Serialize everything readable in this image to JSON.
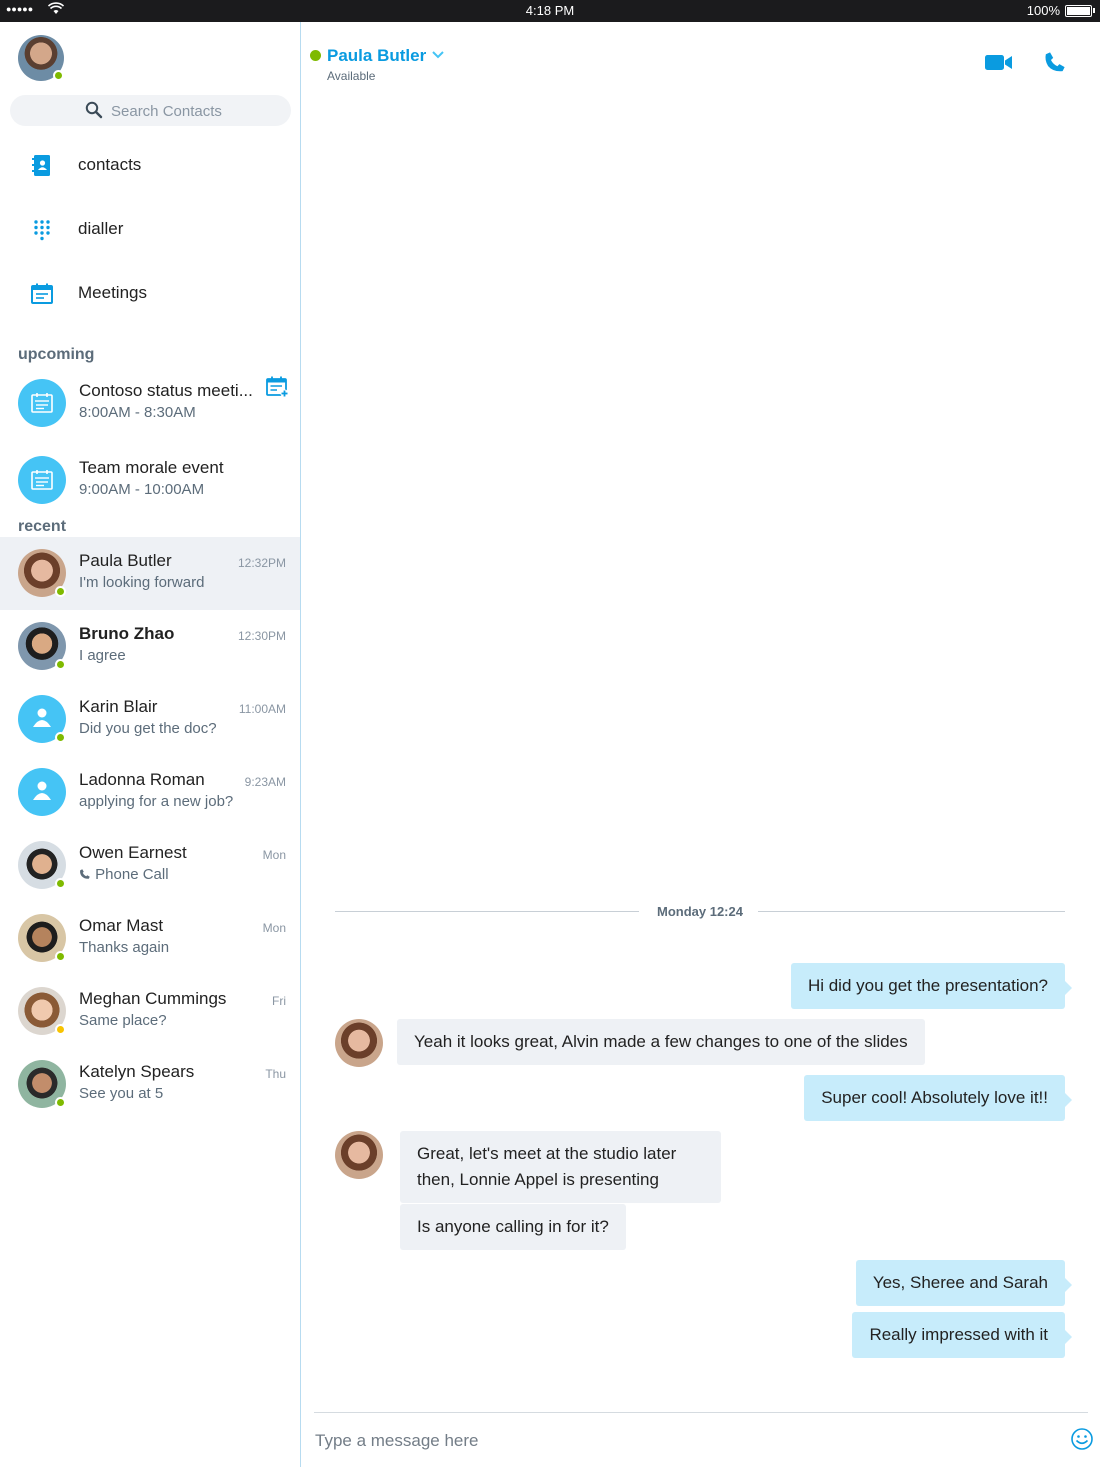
{
  "status_bar": {
    "signal": "●●●●●",
    "time": "4:18 PM",
    "battery": "100%"
  },
  "sidebar": {
    "search_placeholder": "Search Contacts",
    "nav": [
      {
        "label": "contacts",
        "icon": "contacts-book-icon"
      },
      {
        "label": "dialler",
        "icon": "dialpad-icon"
      },
      {
        "label": "Meetings",
        "icon": "calendar-icon"
      }
    ],
    "upcoming_title": "upcoming",
    "upcoming": [
      {
        "title": "Contoso status meeti...",
        "time": "8:00AM - 8:30AM"
      },
      {
        "title": "Team morale event",
        "time": "9:00AM - 10:00AM"
      }
    ],
    "recent_title": "recent",
    "recent": [
      {
        "name": "Paula Butler",
        "message": "I'm looking forward",
        "time": "12:32PM",
        "presence": "online"
      },
      {
        "name": "Bruno Zhao",
        "message": "I agree",
        "time": "12:30PM",
        "presence": "online"
      },
      {
        "name": "Karin Blair",
        "message": "Did you get the doc?",
        "time": "11:00AM",
        "presence": "online"
      },
      {
        "name": "Ladonna Roman",
        "message": "applying for a new job?",
        "time": "9:23AM",
        "presence": "none"
      },
      {
        "name": "Owen Earnest",
        "message": "Phone Call",
        "time": "Mon",
        "presence": "online"
      },
      {
        "name": "Omar Mast",
        "message": "Thanks again",
        "time": "Mon",
        "presence": "online"
      },
      {
        "name": "Meghan Cummings",
        "message": "Same place?",
        "time": "Fri",
        "presence": "away"
      },
      {
        "name": "Katelyn Spears",
        "message": "See you at 5",
        "time": "Thu",
        "presence": "online"
      }
    ]
  },
  "chat": {
    "contact_name": "Paula Butler",
    "contact_status": "Available",
    "date_divider": "Monday 12:24",
    "messages": [
      {
        "dir": "out",
        "text": "Hi did you get the presentation?"
      },
      {
        "dir": "in",
        "text": "Yeah it looks great, Alvin made a few changes to one of the slides"
      },
      {
        "dir": "out",
        "text": "Super cool! Absolutely love it!!"
      },
      {
        "dir": "in",
        "text": "Great, let's meet at the studio later then, Lonnie Appel is presenting"
      },
      {
        "dir": "in",
        "text": "Is anyone calling in for it?"
      },
      {
        "dir": "out",
        "text": "Yes, Sheree and Sarah"
      },
      {
        "dir": "out",
        "text": "Really impressed with it"
      }
    ],
    "composer_placeholder": "Type a message here"
  },
  "colors": {
    "accent": "#0a9be0",
    "online": "#7fba00",
    "away": "#f8c300",
    "bubble_out": "#c7ecfb",
    "bubble_in": "#eef1f5"
  }
}
